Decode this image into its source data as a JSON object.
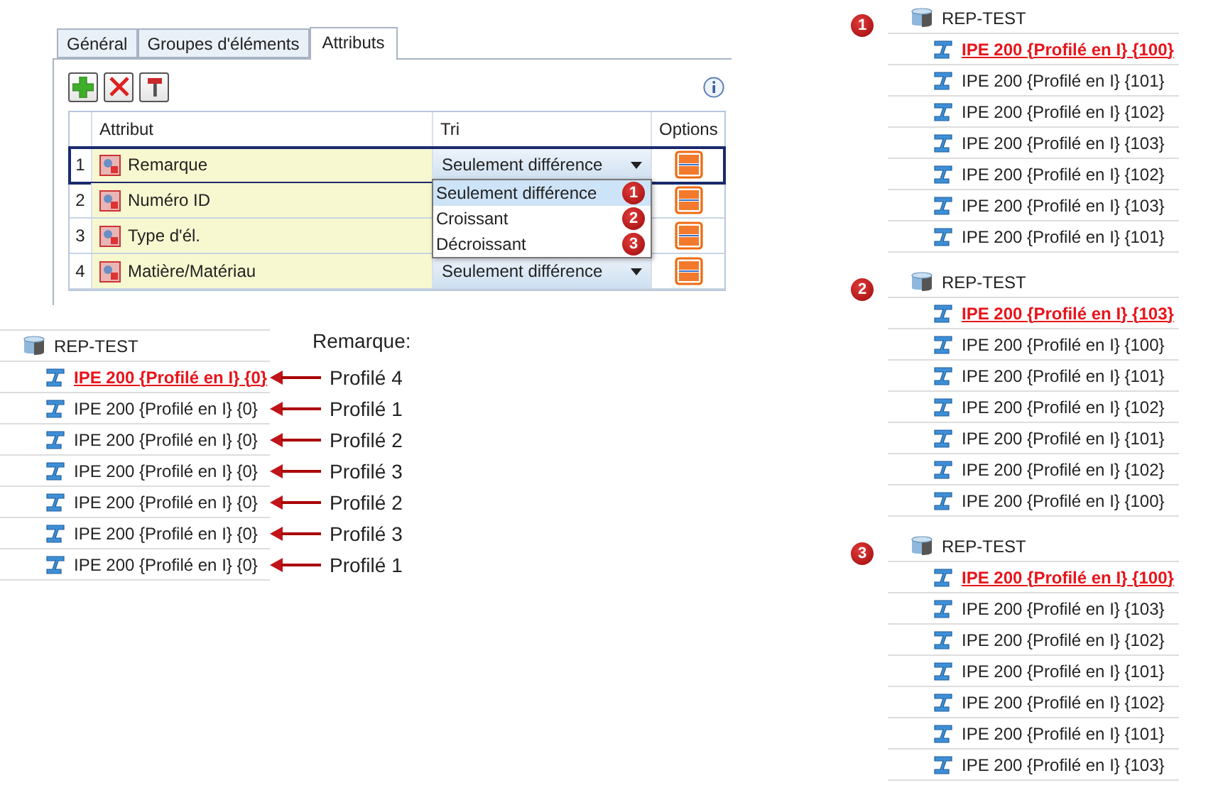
{
  "panel": {
    "tabs": [
      {
        "label": "Général",
        "selected": false
      },
      {
        "label": "Groupes d'éléments",
        "selected": false
      },
      {
        "label": "Attributs",
        "selected": true
      }
    ],
    "table": {
      "columns": [
        "Attribut",
        "Tri",
        "Options"
      ],
      "rows": [
        {
          "number": "1",
          "attribute": "Remarque",
          "sort": "Seulement différence",
          "selected": true
        },
        {
          "number": "2",
          "attribute": "Numéro ID",
          "selected": false
        },
        {
          "number": "3",
          "attribute": "Type d'él.",
          "selected": false
        },
        {
          "number": "4",
          "attribute": "Matière/Matériau",
          "sort": "Seulement différence",
          "selected": false
        }
      ]
    },
    "dropdown": {
      "options": [
        {
          "label": "Seulement différence",
          "badge": "1",
          "selected": true
        },
        {
          "label": "Croissant",
          "badge": "2",
          "selected": false
        },
        {
          "label": "Décroissant",
          "badge": "3",
          "selected": false
        }
      ]
    }
  },
  "example": {
    "caption": "Remarque:",
    "tree": {
      "root": "REP-TEST",
      "items": [
        {
          "label": "IPE 200 {Profilé en I} {0}",
          "selected": true,
          "note": "Profilé 4"
        },
        {
          "label": "IPE 200 {Profilé en I} {0}",
          "selected": false,
          "note": "Profilé 1"
        },
        {
          "label": "IPE 200 {Profilé en I} {0}",
          "selected": false,
          "note": "Profilé 2"
        },
        {
          "label": "IPE 200 {Profilé en I} {0}",
          "selected": false,
          "note": "Profilé 3"
        },
        {
          "label": "IPE 200 {Profilé en I} {0}",
          "selected": false,
          "note": "Profilé 2"
        },
        {
          "label": "IPE 200 {Profilé en I} {0}",
          "selected": false,
          "note": "Profilé 3"
        },
        {
          "label": "IPE 200 {Profilé en I} {0}",
          "selected": false,
          "note": "Profilé 1"
        }
      ]
    }
  },
  "results": [
    {
      "badge": "1",
      "root": "REP-TEST",
      "items": [
        {
          "label": "IPE 200 {Profilé en I} {100}",
          "selected": true
        },
        {
          "label": "IPE 200 {Profilé en I} {101}",
          "selected": false
        },
        {
          "label": "IPE 200 {Profilé en I} {102}",
          "selected": false
        },
        {
          "label": "IPE 200 {Profilé en I} {103}",
          "selected": false
        },
        {
          "label": "IPE 200 {Profilé en I} {102}",
          "selected": false
        },
        {
          "label": "IPE 200 {Profilé en I} {103}",
          "selected": false
        },
        {
          "label": "IPE 200 {Profilé en I} {101}",
          "selected": false
        }
      ]
    },
    {
      "badge": "2",
      "root": "REP-TEST",
      "items": [
        {
          "label": "IPE 200 {Profilé en I} {103}",
          "selected": true
        },
        {
          "label": "IPE 200 {Profilé en I} {100}",
          "selected": false
        },
        {
          "label": "IPE 200 {Profilé en I} {101}",
          "selected": false
        },
        {
          "label": "IPE 200 {Profilé en I} {102}",
          "selected": false
        },
        {
          "label": "IPE 200 {Profilé en I} {101}",
          "selected": false
        },
        {
          "label": "IPE 200 {Profilé en I} {102}",
          "selected": false
        },
        {
          "label": "IPE 200 {Profilé en I} {100}",
          "selected": false
        }
      ]
    },
    {
      "badge": "3",
      "root": "REP-TEST",
      "items": [
        {
          "label": "IPE 200 {Profilé en I} {100}",
          "selected": true
        },
        {
          "label": "IPE 200 {Profilé en I} {103}",
          "selected": false
        },
        {
          "label": "IPE 200 {Profilé en I} {102}",
          "selected": false
        },
        {
          "label": "IPE 200 {Profilé en I} {101}",
          "selected": false
        },
        {
          "label": "IPE 200 {Profilé en I} {102}",
          "selected": false
        },
        {
          "label": "IPE 200 {Profilé en I} {101}",
          "selected": false
        },
        {
          "label": "IPE 200 {Profilé en I} {103}",
          "selected": false
        }
      ]
    }
  ]
}
